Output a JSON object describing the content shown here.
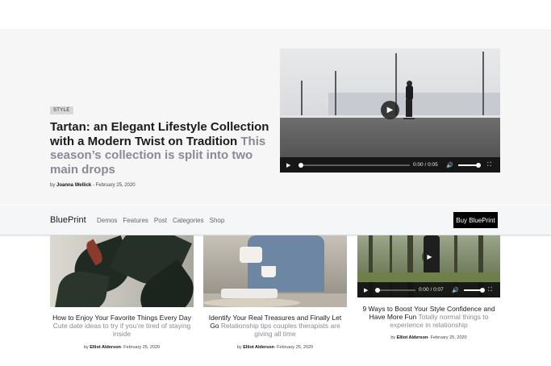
{
  "hero": {
    "badge": "STYLE",
    "title": "Tartan: an Elegant Lifestyle Collection with a Modern Twist on Tradition",
    "subtitle": "This season’s collection is split into two main drops",
    "byline_prefix": "by",
    "author": "Joanna Wellick",
    "date": "- February 25, 2020",
    "video": {
      "current_time": "0:00",
      "separator": "/",
      "duration": "0:05",
      "progress": 0.0,
      "volume": 1.0
    }
  },
  "navbar": {
    "brand": "BluePrint",
    "links": [
      "Demos",
      "Features",
      "Post",
      "Categories",
      "Shop"
    ],
    "cta": "Buy BluePrint"
  },
  "cards": [
    {
      "title": "How to Enjoy Your Favorite Things Every Day",
      "subtitle": "Cute date ideas to try if you’re tired of staying inside",
      "byline_prefix": "by",
      "author": "Elliot Alderson",
      "date": "- February 25, 2020"
    },
    {
      "title": "Identify Your Real Treasures and Finally Let Go",
      "subtitle": "Relationship tips couples therapists are giving all time",
      "byline_prefix": "by",
      "author": "Elliot Alderson",
      "date": "- February 25, 2020"
    },
    {
      "title": "9 Ways to Boost Your Style Confidence and Have More Fun",
      "subtitle": "Totally normal things to experience in relationship",
      "byline_prefix": "by",
      "author": "Elliot Alderson",
      "date": "- February 25, 2020",
      "video": {
        "current_time": "0:00",
        "separator": "/",
        "duration": "0:07",
        "progress": 0.0,
        "volume": 1.0
      }
    }
  ],
  "icons": {
    "play": "play-icon",
    "volume": "volume-icon",
    "fullscreen": "fullscreen-icon"
  },
  "colors": {
    "accent": "#000000",
    "muted_text": "#8a8a96",
    "hero_bg": "#f6f6f7",
    "navbar_bg": "#f4f6f8"
  }
}
